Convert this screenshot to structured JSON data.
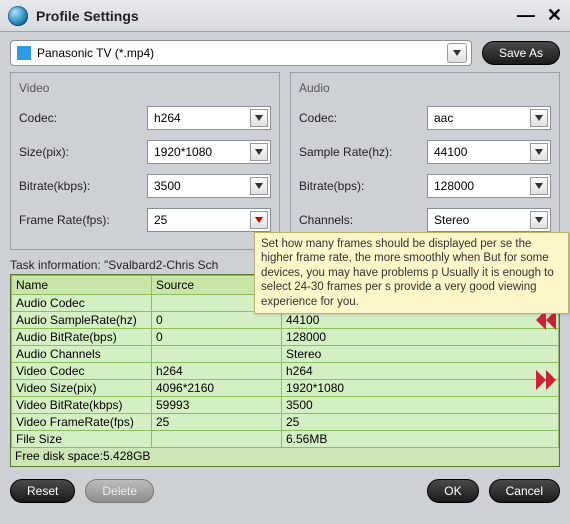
{
  "window": {
    "title": "Profile Settings"
  },
  "top": {
    "profile": "Panasonic TV (*.mp4)",
    "save_as": "Save As"
  },
  "video": {
    "title": "Video",
    "codec_lbl": "Codec:",
    "codec": "h264",
    "size_lbl": "Size(pix):",
    "size": "1920*1080",
    "bitrate_lbl": "Bitrate(kbps):",
    "bitrate": "3500",
    "fps_lbl": "Frame Rate(fps):",
    "fps": "25"
  },
  "audio": {
    "title": "Audio",
    "codec_lbl": "Codec:",
    "codec": "aac",
    "sr_lbl": "Sample Rate(hz):",
    "sr": "44100",
    "bitrate_lbl": "Bitrate(bps):",
    "bitrate": "128000",
    "ch_lbl": "Channels:",
    "ch": "Stereo"
  },
  "task": {
    "heading": "Task information: \"Svalbard2-Chris Sch",
    "headers": {
      "name": "Name",
      "source": "Source",
      "target": ""
    },
    "rows": [
      {
        "name": "Audio Codec",
        "src": "",
        "tgt": ""
      },
      {
        "name": "Audio SampleRate(hz)",
        "src": "0",
        "tgt": "44100"
      },
      {
        "name": "Audio BitRate(bps)",
        "src": "0",
        "tgt": "128000"
      },
      {
        "name": "Audio Channels",
        "src": "",
        "tgt": "Stereo"
      },
      {
        "name": "Video Codec",
        "src": "h264",
        "tgt": "h264"
      },
      {
        "name": "Video Size(pix)",
        "src": "4096*2160",
        "tgt": "1920*1080"
      },
      {
        "name": "Video BitRate(kbps)",
        "src": "59993",
        "tgt": "3500"
      },
      {
        "name": "Video FrameRate(fps)",
        "src": "25",
        "tgt": "25"
      },
      {
        "name": "File Size",
        "src": "",
        "tgt": "6.56MB"
      }
    ],
    "free": "Free disk space:5.428GB"
  },
  "tooltip": "Set how many frames should be displayed per se the higher frame rate, the more smoothly when But for some devices, you may have problems p Usually it is enough to select 24-30 frames per s provide a very good viewing experience for you.",
  "footer": {
    "reset": "Reset",
    "delete": "Delete",
    "ok": "OK",
    "cancel": "Cancel"
  }
}
